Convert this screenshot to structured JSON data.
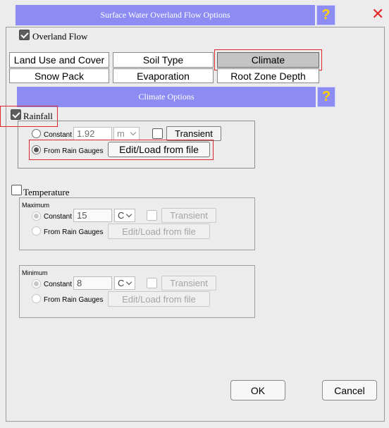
{
  "window": {
    "title": "Surface Water Overland Flow Options",
    "help_label": "?",
    "close_label": "✕"
  },
  "overland_flow": {
    "label": "Overland Flow",
    "checked": true
  },
  "tabs": [
    {
      "label": "Land Use and Cover"
    },
    {
      "label": "Soil Type"
    },
    {
      "label": "Climate",
      "active": true
    },
    {
      "label": "Snow Pack"
    },
    {
      "label": "Evaporation"
    },
    {
      "label": "Root Zone Depth"
    }
  ],
  "climate_options": {
    "title": "Climate Options",
    "help_label": "?"
  },
  "rainfall": {
    "label": "Rainfall",
    "checked": true,
    "constant_label": "Constant",
    "constant_value": "1.92",
    "unit": "m",
    "transient_label": "Transient",
    "from_gauges_label": "From Rain Gauges",
    "selected": "from_gauges",
    "edit_label": "Edit/Load from file"
  },
  "temperature": {
    "label": "Temperature",
    "checked": false,
    "maximum": {
      "title": "Maximum",
      "constant_label": "Constant",
      "constant_value": "15",
      "unit": "C",
      "transient_label": "Transient",
      "from_gauges_label": "From Rain Gauges",
      "edit_label": "Edit/Load from file"
    },
    "minimum": {
      "title": "Minimum",
      "constant_label": "Constant",
      "constant_value": "8",
      "unit": "C",
      "transient_label": "Transient",
      "from_gauges_label": "From Rain Gauges",
      "edit_label": "Edit/Load from file"
    }
  },
  "footer": {
    "ok_label": "OK",
    "cancel_label": "Cancel"
  },
  "colors": {
    "title_bar": "#8c8cf2",
    "help_mark": "#ffd400",
    "close_x": "#e8262a",
    "highlight": "#e0262a"
  },
  "icons": {
    "close": "close-icon",
    "help": "help-icon",
    "dropdown": "chevron-down-icon"
  }
}
